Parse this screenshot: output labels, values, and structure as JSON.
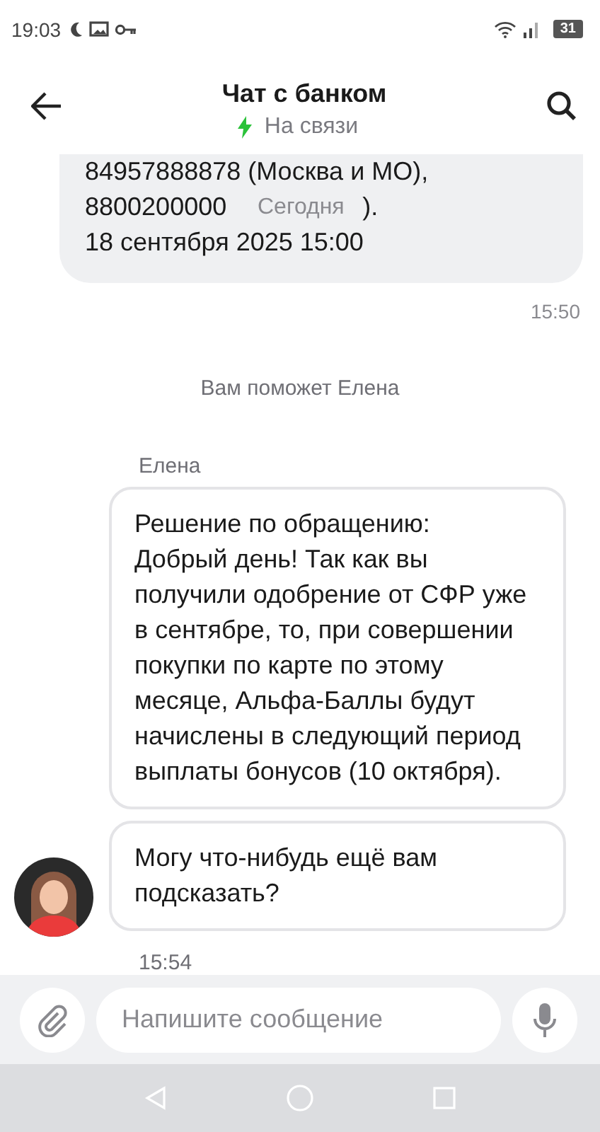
{
  "status_bar": {
    "time": "19:03",
    "battery": "31"
  },
  "header": {
    "title": "Чат с банком",
    "status": "На связи"
  },
  "previous_message": {
    "lines": [
      "84957888878 (Москва и МО),",
      "8800200000",
      "18 сентября 2025 15:00"
    ],
    "line_tail": ")."
  },
  "date_chip": "Сегодня",
  "previous_time": "15:50",
  "system_note": "Вам поможет Елена",
  "operator_name": "Елена",
  "messages": [
    {
      "text": "Решение по обращению: Добрый день! Так как вы получили одобрение от СФР уже в сентябре, то, при совершении покупки по карте по этому месяце, Альфа-Баллы будут начислены в следующий период выплаты бонусов (10 октября).",
      "avatar": false
    },
    {
      "text": "Могу что-нибудь ещё вам подсказать?",
      "avatar": true
    }
  ],
  "last_time": "15:54",
  "composer": {
    "placeholder": "Напишите сообщение"
  }
}
